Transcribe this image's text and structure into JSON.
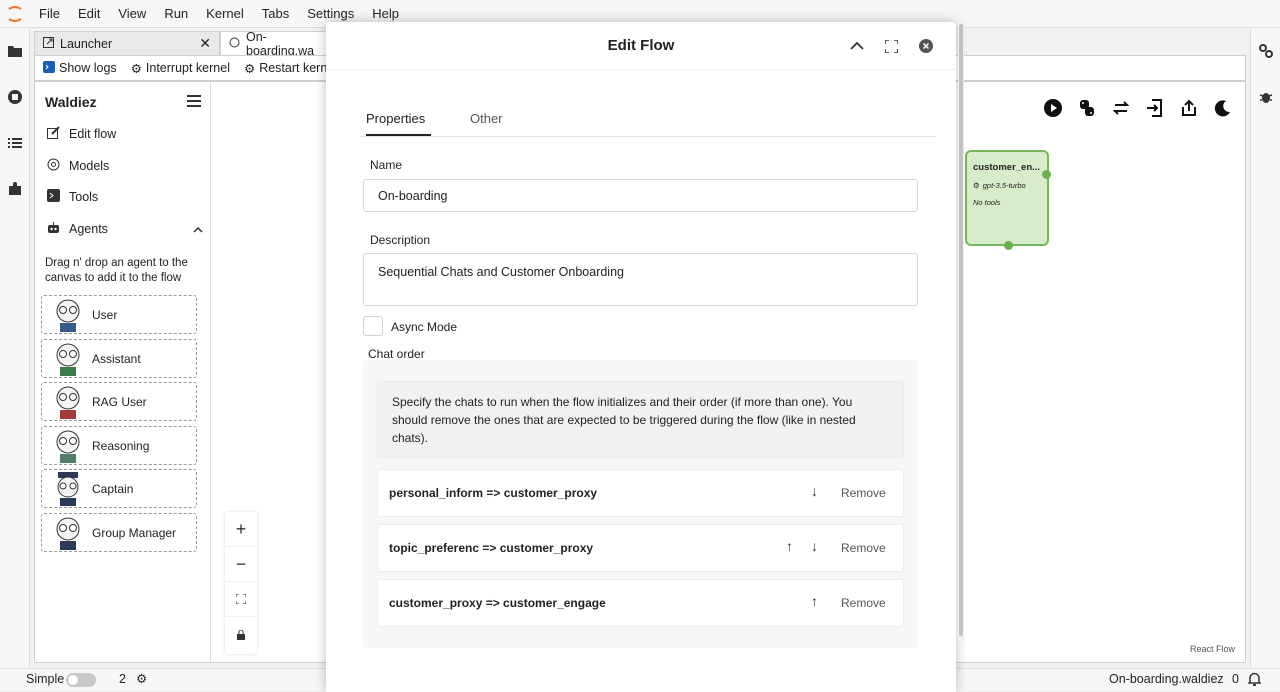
{
  "menubar": {
    "items": [
      "File",
      "Edit",
      "View",
      "Run",
      "Kernel",
      "Tabs",
      "Settings",
      "Help"
    ]
  },
  "tabs": {
    "launcher": "Launcher",
    "file": "On-boarding.wa"
  },
  "toolbar": {
    "show_logs": "Show logs",
    "interrupt": "Interrupt kernel",
    "restart": "Restart kernel"
  },
  "sidebar": {
    "title": "Waldiez",
    "items": [
      {
        "label": "Edit flow",
        "icon": "edit-icon"
      },
      {
        "label": "Models",
        "icon": "model-icon"
      },
      {
        "label": "Tools",
        "icon": "terminal-icon"
      },
      {
        "label": "Agents",
        "icon": "robot-icon"
      }
    ],
    "hint": "Drag n' drop an agent to the canvas to add it to the flow",
    "agents": [
      "User",
      "Assistant",
      "RAG User",
      "Reasoning",
      "Captain",
      "Group Manager"
    ]
  },
  "node": {
    "title": "customer_en...",
    "model": "gpt-3.5-turbo",
    "tools": "No tools"
  },
  "canvas": {
    "watermark": "React Flow"
  },
  "modal": {
    "title": "Edit Flow",
    "tabs": [
      "Properties",
      "Other"
    ],
    "name_label": "Name",
    "name_value": "On-boarding",
    "description_label": "Description",
    "description_value": "Sequential Chats and Customer Onboarding",
    "async_label": "Async Mode",
    "chat_order_label": "Chat order",
    "chat_order_help": "Specify the chats to run when the flow initializes and their order (if more than one). You should remove the ones that are expected to be triggered during the flow (like in nested chats).",
    "chats": [
      {
        "name": "personal_inform => customer_proxy",
        "remove": "Remove"
      },
      {
        "name": "topic_preferenc => customer_proxy",
        "remove": "Remove"
      },
      {
        "name": "customer_proxy => customer_engage",
        "remove": "Remove"
      }
    ]
  },
  "statusbar": {
    "mode": "Simple",
    "count": "2",
    "filename": "On-boarding.waldiez",
    "notifications": "0"
  }
}
